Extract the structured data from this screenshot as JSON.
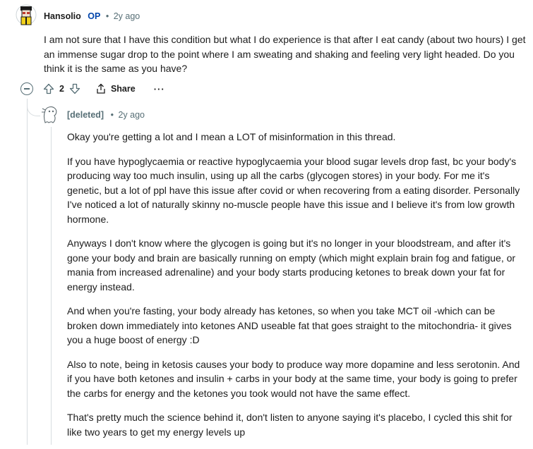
{
  "op_comment": {
    "author": "Hansolio",
    "op_tag": "OP",
    "separator": "•",
    "time": "2y ago",
    "body": "I am not sure that I have this condition but what I do experience is that after I eat candy (about two hours) I get an immense sugar drop to the point where I am sweating and shaking and feeling very light headed. Do you think it is the same as you have?",
    "actions": {
      "upvote_icon": "arrow-up-icon",
      "score": "2",
      "downvote_icon": "arrow-down-icon",
      "share_label": "Share",
      "more_label": "···"
    }
  },
  "reply_comment": {
    "author": "[deleted]",
    "separator": "•",
    "time": "2y ago",
    "paragraphs": [
      "Okay you're getting a lot and I mean a LOT of misinformation in this thread.",
      "If you have hypoglycaemia or reactive hypoglycaemia your blood sugar levels drop fast, bc your body's producing way too much insulin, using up all the carbs (glycogen stores) in your body. For me it's genetic, but a lot of ppl have this issue after covid or when recovering from a eating disorder. Personally I've noticed a lot of naturally skinny no-muscle people have this issue and I believe it's from low growth hormone.",
      "Anyways I don't know where the glycogen is going but it's no longer in your bloodstream, and after it's gone your body and brain are basically running on empty (which might explain brain fog and fatigue, or mania from increased adrenaline) and your body starts producing ketones to break down your fat for energy instead.",
      "And when you're fasting, your body already has ketones, so when you take MCT oil -which can be broken down immediately into ketones AND useable fat that goes straight to the mitochondria- it gives you a huge boost of energy :D",
      "Also to note, being in ketosis causes your body to produce way more dopamine and less serotonin. And if you have both ketones and insulin + carbs in your body at the same time, your body is going to prefer the carbs for energy and the ketones you took would not have the same effect.",
      "That's pretty much the science behind it, don't listen to anyone saying it's placebo, I cycled this shit for like two years to get my energy levels up"
    ]
  },
  "colors": {
    "op_tag": "#0045ac",
    "meta_text": "#576f76",
    "thread_line": "#d8dde0",
    "body_text": "#1c1c1c"
  }
}
